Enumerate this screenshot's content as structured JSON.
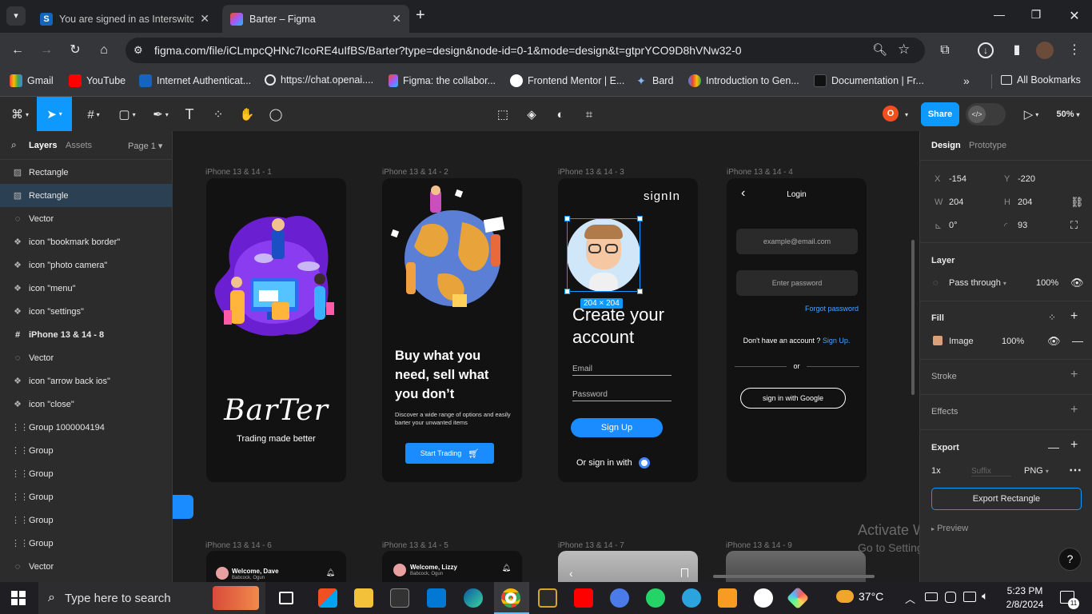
{
  "browser": {
    "tabs": [
      {
        "title": "You are signed in as Interswitch",
        "active": false
      },
      {
        "title": "Barter – Figma",
        "active": true
      }
    ],
    "url": "figma.com/file/iCLmpcQHNc7IcoRE4uIfBS/Barter?type=design&node-id=0-1&mode=design&t=gtprYCO9D8hVNw32-0",
    "bookmarks": [
      "Gmail",
      "YouTube",
      "Internet Authenticat...",
      "https://chat.openai....",
      "Figma: the collabor...",
      "Frontend Mentor | E...",
      "Bard",
      "Introduction to Gen...",
      "Documentation | Fr..."
    ],
    "all_bookmarks": "All Bookmarks"
  },
  "figma": {
    "toolbar": {
      "avatar_letter": "O",
      "share": "Share",
      "zoom": "50%"
    },
    "left_panel": {
      "tabs": [
        "Layers",
        "Assets"
      ],
      "page": "Page 1",
      "layers": [
        {
          "name": "Rectangle",
          "icon": "image-icon",
          "selected": false
        },
        {
          "name": "Rectangle",
          "icon": "image-icon",
          "selected": true
        },
        {
          "name": "Vector",
          "icon": "vector-icon",
          "selected": false
        },
        {
          "name": "icon \"bookmark border\"",
          "icon": "component-icon",
          "selected": false
        },
        {
          "name": "icon \"photo camera\"",
          "icon": "component-icon",
          "selected": false
        },
        {
          "name": "icon \"menu\"",
          "icon": "component-icon",
          "selected": false
        },
        {
          "name": "icon \"settings\"",
          "icon": "component-icon",
          "selected": false
        },
        {
          "name": "iPhone 13 & 14 - 8",
          "icon": "frame-icon",
          "selected": false
        },
        {
          "name": "Vector",
          "icon": "vector-icon",
          "selected": false
        },
        {
          "name": "icon \"arrow back ios\"",
          "icon": "component-icon",
          "selected": false
        },
        {
          "name": "icon \"close\"",
          "icon": "component-icon",
          "selected": false
        },
        {
          "name": "Group 1000004194",
          "icon": "group-icon",
          "selected": false
        },
        {
          "name": "Group",
          "icon": "group-icon",
          "selected": false
        },
        {
          "name": "Group",
          "icon": "group-icon",
          "selected": false
        },
        {
          "name": "Group",
          "icon": "group-icon",
          "selected": false
        },
        {
          "name": "Group",
          "icon": "group-icon",
          "selected": false
        },
        {
          "name": "Group",
          "icon": "group-icon",
          "selected": false
        },
        {
          "name": "Vector",
          "icon": "vector-icon",
          "selected": false
        }
      ]
    },
    "canvas": {
      "frame_labels": [
        "iPhone 13 & 14 - 1",
        "iPhone 13 & 14 - 2",
        "iPhone 13 & 14 - 3",
        "iPhone 13 & 14 - 4",
        "iPhone 13 & 14 - 6",
        "iPhone 13 & 14 - 5",
        "iPhone 13 & 14 - 7",
        "iPhone 13 & 14 - 9"
      ],
      "f1": {
        "brand": "BarTer",
        "tagline": "Trading made better"
      },
      "f2": {
        "headline": "Buy what  you need, sell what you don’t",
        "sub": "Discover a wide range of options and easily barter your unwanted items",
        "cta": "Start Trading"
      },
      "f3": {
        "title": "signIn",
        "heading": "Create your account",
        "email": "Email",
        "password": "Password",
        "signup": "Sign Up",
        "or_sign": "Or sign in with",
        "selection": "204 × 204"
      },
      "f4": {
        "title": "Login",
        "email_ph": "example@email.com",
        "pass_ph": "Enter password",
        "forgot": "Forgot password",
        "no_account": "Don't have an account ?",
        "signup_link": "Sign Up.",
        "or": "or",
        "google": "sign in with Google"
      },
      "f6": {
        "welcome": "Welcome, Dave",
        "loc": "Babcock, Ogun"
      },
      "f5": {
        "welcome": "Welcome, Lizzy",
        "loc": "Babcock, Ogun"
      }
    },
    "right_panel": {
      "tabs": [
        "Design",
        "Prototype"
      ],
      "x": "-154",
      "y": "-220",
      "w": "204",
      "h": "204",
      "rotation": "0°",
      "radius": "93",
      "layer_title": "Layer",
      "blend": "Pass through",
      "opacity": "100%",
      "fill_title": "Fill",
      "fill_type": "Image",
      "fill_opacity": "100%",
      "stroke": "Stroke",
      "effects": "Effects",
      "export": "Export",
      "scale": "1x",
      "suffix": "Suffix",
      "format": "PNG",
      "export_btn": "Export Rectangle",
      "preview": "Preview"
    },
    "watermark": {
      "line1": "Activate Windows",
      "line2": "Go to Settings to activate Windows."
    }
  },
  "taskbar": {
    "search": "Type here to search",
    "temp": "37°C",
    "time": "5:23 PM",
    "date": "2/8/2024",
    "notif": "11"
  },
  "colors": {
    "figma_blue": "#0d99ff",
    "barter_blue": "#1a8cff"
  }
}
